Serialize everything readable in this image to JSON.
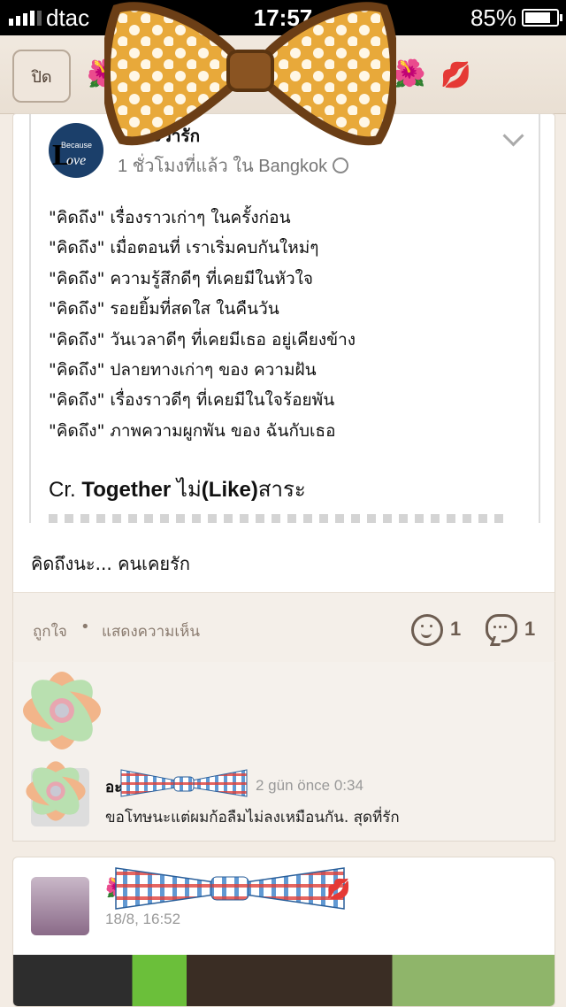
{
  "status_bar": {
    "carrier": "dtac",
    "time": "17:57",
    "battery": "85%"
  },
  "topbar": {
    "close_label": "ปิด"
  },
  "post": {
    "page_name": "เพราะว่ารัก",
    "meta": "1 ชั่วโมงที่แล้ว ใน Bangkok",
    "avatar_small": "Because",
    "avatar_big": "L",
    "avatar_word": "ove",
    "poem": [
      "\"คิดถึง\" เรื่องราวเก่าๆ ในครั้งก่อน",
      "\"คิดถึง\" เมื่อตอนที่ เราเริ่มคบกันใหม่ๆ",
      "\"คิดถึง\" ความรู้สึกดีๆ ที่เคยมีในหัวใจ",
      "\"คิดถึง\" รอยยิ้มที่สดใส ในคืนวัน",
      "\"คิดถึง\" วันเวลาดีๆ ที่เคยมีเธอ อยู่เคียงข้าง",
      "\"คิดถึง\" ปลายทางเก่าๆ ของ ความฝัน",
      "\"คิดถึง\" เรื่องราวดีๆ ที่เคยมีในใจร้อยพัน",
      "\"คิดถึง\" ภาพความผูกพัน ของ ฉันกับเธอ"
    ],
    "credit_prefix": "Cr.",
    "credit_bold": "Together",
    "credit_mid": " ไม่",
    "credit_bold2": "(Like)",
    "credit_end": "สาระ",
    "caption": "คิดถึงนะ... คนเคยรัก",
    "like_label": "ถูกใจ",
    "separator": "•",
    "comment_label": "แสดงความเห็น",
    "like_count": "1",
    "comment_count": "1"
  },
  "comment": {
    "author": "อะ",
    "time": "2 gün önce 0:34",
    "text": "ขอโทษนะแต่ผมก้อลืมไม่ลงเหมือนกัน.  สุดที่รัก"
  },
  "next_post": {
    "time": "18/8, 16:52"
  },
  "colors": {
    "background": "#f3ece4",
    "bow_yellow": "#e8a93a",
    "bow_brown": "#7a4a1e",
    "gingham_red": "#e0403a",
    "gingham_blue": "#3a7fc8"
  }
}
